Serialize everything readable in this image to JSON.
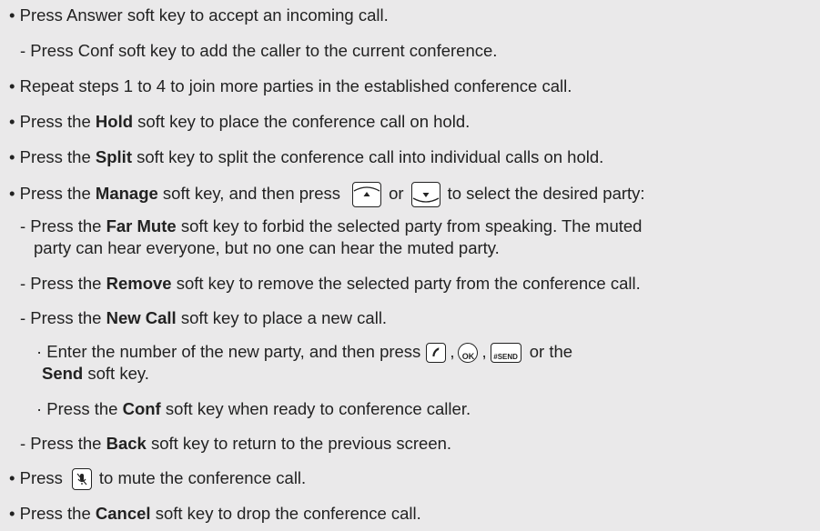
{
  "lines": {
    "answer": "• Press Answer soft key to accept an incoming call.",
    "conf_add": "- Press Conf soft key to add the caller to the current conference.",
    "repeat": "• Repeat steps 1 to 4 to join more parties in the established conference call.",
    "hold": {
      "pre": "• Press the ",
      "bold": "Hold",
      "post": " soft key to place the conference call on hold."
    },
    "split": {
      "pre": "• Press the ",
      "bold": "Split",
      "post": " soft key to split the conference call into individual calls on hold."
    },
    "manage": {
      "pre": "• Press the ",
      "bold": "Manage",
      "mid": " soft key, and then press ",
      "or": "or",
      "post": "to select the desired party:"
    },
    "far_mute": {
      "pre": "- Press the ",
      "bold": "Far Mute",
      "post": " soft key to forbid the selected party from speaking. The muted",
      "cont": "party can hear everyone, but no one can hear the muted party."
    },
    "remove": {
      "pre": "- Press the ",
      "bold": "Remove",
      "post": " soft key to remove the selected party from the conference call."
    },
    "new_call": {
      "pre": "- Press the ",
      "bold": "New Call",
      "post": " soft key to place a new call."
    },
    "enter_number": {
      "pre": "· Enter the number of the new party, and then press",
      "sep1": ",",
      "sep2": ",",
      "post": " or the",
      "cont_bold": "Send",
      "cont_post": " soft key."
    },
    "conf_ready": {
      "pre": "· Press the ",
      "bold": "Conf",
      "post": " soft key when ready to conference caller."
    },
    "back": {
      "pre": "- Press the ",
      "bold": "Back",
      "post": " soft key to return to the previous screen."
    },
    "mute": {
      "pre": "• Press",
      "post": "to mute the conference call."
    },
    "cancel": {
      "pre": "• Press the ",
      "bold": "Cancel",
      "post": " soft key to drop the conference call."
    }
  },
  "keys": {
    "ok_label": "OK",
    "send_label": "#SEND",
    "icons": [
      "up-arrow-key",
      "down-arrow-key",
      "handset-key",
      "ok-key",
      "send-key",
      "mute-key"
    ]
  }
}
